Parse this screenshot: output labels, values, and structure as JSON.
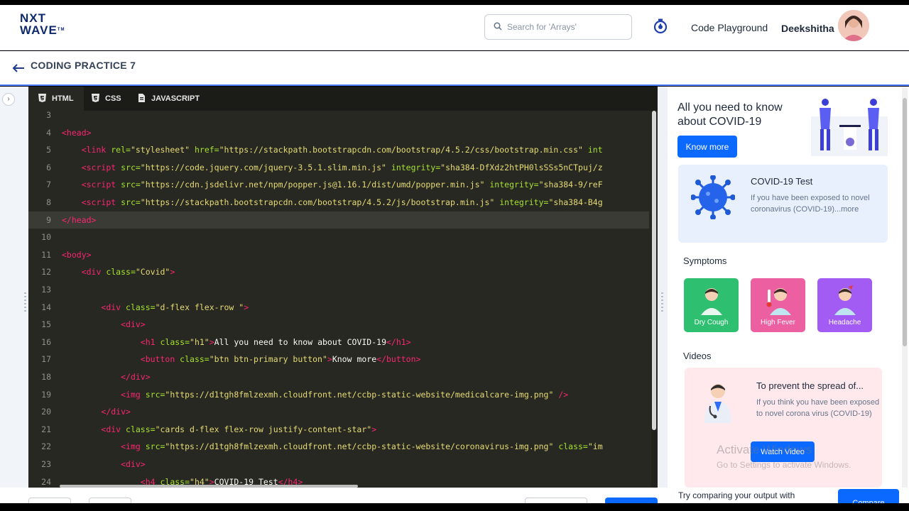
{
  "header": {
    "logo_line1": "NXT",
    "logo_line2": "WAVE",
    "logo_mark": "TM",
    "search_placeholder": "Search for 'Arrays'",
    "search_icon": "search-icon",
    "timer_icon": "stopwatch-icon",
    "code_playground": "Code Playground",
    "user_name": "Deekshitha"
  },
  "subheader": {
    "back_icon": "arrow-left-icon",
    "title": "CODING PRACTICE 7"
  },
  "editor": {
    "tabs": [
      {
        "label": "HTML",
        "icon": "html5-icon",
        "active": true
      },
      {
        "label": "CSS",
        "icon": "css3-icon",
        "active": false
      },
      {
        "label": "JAVASCRIPT",
        "icon": "js-icon",
        "active": false
      }
    ],
    "current_line": 9,
    "lines": [
      {
        "n": "3",
        "indent": 0,
        "parts": []
      },
      {
        "n": "4",
        "indent": 0,
        "parts": [
          [
            "tg",
            "<head>"
          ]
        ]
      },
      {
        "n": "5",
        "indent": 4,
        "parts": [
          [
            "tg",
            "<link "
          ],
          [
            "at",
            "rel="
          ],
          [
            "st",
            "\"stylesheet\" "
          ],
          [
            "at",
            "href="
          ],
          [
            "st",
            "\"https://stackpath.bootstrapcdn.com/bootstrap/4.5.2/css/bootstrap.min.css\" "
          ],
          [
            "at",
            "int"
          ]
        ]
      },
      {
        "n": "6",
        "indent": 4,
        "parts": [
          [
            "tg",
            "<script "
          ],
          [
            "at",
            "src="
          ],
          [
            "st",
            "\"https://code.jquery.com/jquery-3.5.1.slim.min.js\" "
          ],
          [
            "at",
            "integrity="
          ],
          [
            "st",
            "\"sha384-DfXdz2htPH0lsSSs5nCTpuj/z"
          ]
        ]
      },
      {
        "n": "7",
        "indent": 4,
        "parts": [
          [
            "tg",
            "<script "
          ],
          [
            "at",
            "src="
          ],
          [
            "st",
            "\"https://cdn.jsdelivr.net/npm/popper.js@1.16.1/dist/umd/popper.min.js\" "
          ],
          [
            "at",
            "integrity="
          ],
          [
            "st",
            "\"sha384-9/reF"
          ]
        ]
      },
      {
        "n": "8",
        "indent": 4,
        "parts": [
          [
            "tg",
            "<script "
          ],
          [
            "at",
            "src="
          ],
          [
            "st",
            "\"https://stackpath.bootstrapcdn.com/bootstrap/4.5.2/js/bootstrap.min.js\" "
          ],
          [
            "at",
            "integrity="
          ],
          [
            "st",
            "\"sha384-B4g"
          ]
        ]
      },
      {
        "n": "9",
        "indent": 0,
        "parts": [
          [
            "tg",
            "</head>"
          ]
        ]
      },
      {
        "n": "10",
        "indent": 0,
        "parts": []
      },
      {
        "n": "11",
        "indent": 0,
        "parts": [
          [
            "tg",
            "<body>"
          ]
        ]
      },
      {
        "n": "12",
        "indent": 4,
        "parts": [
          [
            "tg",
            "<div "
          ],
          [
            "at",
            "class="
          ],
          [
            "st",
            "\"Covid\""
          ],
          [
            "tg",
            ">"
          ]
        ]
      },
      {
        "n": "13",
        "indent": 0,
        "parts": []
      },
      {
        "n": "14",
        "indent": 8,
        "parts": [
          [
            "tg",
            "<div "
          ],
          [
            "at",
            "class="
          ],
          [
            "st",
            "\"d-flex flex-row \""
          ],
          [
            "tg",
            ">"
          ]
        ]
      },
      {
        "n": "15",
        "indent": 12,
        "parts": [
          [
            "tg",
            "<div>"
          ]
        ]
      },
      {
        "n": "16",
        "indent": 16,
        "parts": [
          [
            "tg",
            "<h1 "
          ],
          [
            "at",
            "class="
          ],
          [
            "st",
            "\"h1\""
          ],
          [
            "tg",
            ">"
          ],
          [
            "pl",
            "All you need to know about COVID-19"
          ],
          [
            "tg",
            "</h1>"
          ]
        ]
      },
      {
        "n": "17",
        "indent": 16,
        "parts": [
          [
            "tg",
            "<button "
          ],
          [
            "at",
            "class="
          ],
          [
            "st",
            "\"btn btn-primary button\""
          ],
          [
            "tg",
            ">"
          ],
          [
            "pl",
            "Know more"
          ],
          [
            "tg",
            "</button>"
          ]
        ]
      },
      {
        "n": "18",
        "indent": 12,
        "parts": [
          [
            "tg",
            "</div>"
          ]
        ]
      },
      {
        "n": "19",
        "indent": 12,
        "parts": [
          [
            "tg",
            "<img "
          ],
          [
            "at",
            "src="
          ],
          [
            "st",
            "\"https://d1tgh8fmlzexmh.cloudfront.net/ccbp-static-website/medicalcare-img.png\" "
          ],
          [
            "tg",
            "/>"
          ]
        ]
      },
      {
        "n": "20",
        "indent": 8,
        "parts": [
          [
            "tg",
            "</div>"
          ]
        ]
      },
      {
        "n": "21",
        "indent": 8,
        "parts": [
          [
            "tg",
            "<div "
          ],
          [
            "at",
            "class="
          ],
          [
            "st",
            "\"cards d-flex flex-row justify-content-star\""
          ],
          [
            "tg",
            ">"
          ]
        ]
      },
      {
        "n": "22",
        "indent": 12,
        "parts": [
          [
            "tg",
            "<img "
          ],
          [
            "at",
            "src="
          ],
          [
            "st",
            "\"https://d1tgh8fmlzexmh.cloudfront.net/ccbp-static-website/coronavirus-img.png\" "
          ],
          [
            "at",
            "class="
          ],
          [
            "st",
            "\"im"
          ]
        ]
      },
      {
        "n": "23",
        "indent": 12,
        "parts": [
          [
            "tg",
            "<div>"
          ]
        ]
      },
      {
        "n": "24",
        "indent": 16,
        "parts": [
          [
            "tg",
            "<h4 "
          ],
          [
            "at",
            "class="
          ],
          [
            "st",
            "\"h4\""
          ],
          [
            "tg",
            ">"
          ],
          [
            "pl",
            "COVID-19 Test"
          ],
          [
            "tg",
            "</h4>"
          ]
        ]
      }
    ]
  },
  "preview": {
    "title": "All you need to know about COVID-19",
    "know_more": "Know more",
    "test_title": "COVID-19 Test",
    "test_desc": "If you have been exposed to novel coronavirus (COVID-19)...more",
    "symptoms_heading": "Symptoms",
    "symptoms": [
      {
        "label": "Dry Cough",
        "color": "#2fbf71"
      },
      {
        "label": "High Fever",
        "color": "#ec5fa0"
      },
      {
        "label": "Headache",
        "color": "#a25cf3"
      }
    ],
    "videos_heading": "Videos",
    "video_title": "To prevent the spread of...",
    "video_desc": "If you think you have been exposed to novel corona virus (COVID-19)",
    "watch_video": "Watch Video"
  },
  "watermark": {
    "line1": "Activate Windows",
    "line2": "Go to Settings to activate Windows."
  },
  "footer": {
    "try_text": "Try comparing your output with",
    "compare": "Compare"
  },
  "colors": {
    "accent": "#0b69ff",
    "editor_bg": "#272822",
    "tag": "#f92672",
    "attr": "#a6e22e",
    "string": "#e6db74"
  }
}
